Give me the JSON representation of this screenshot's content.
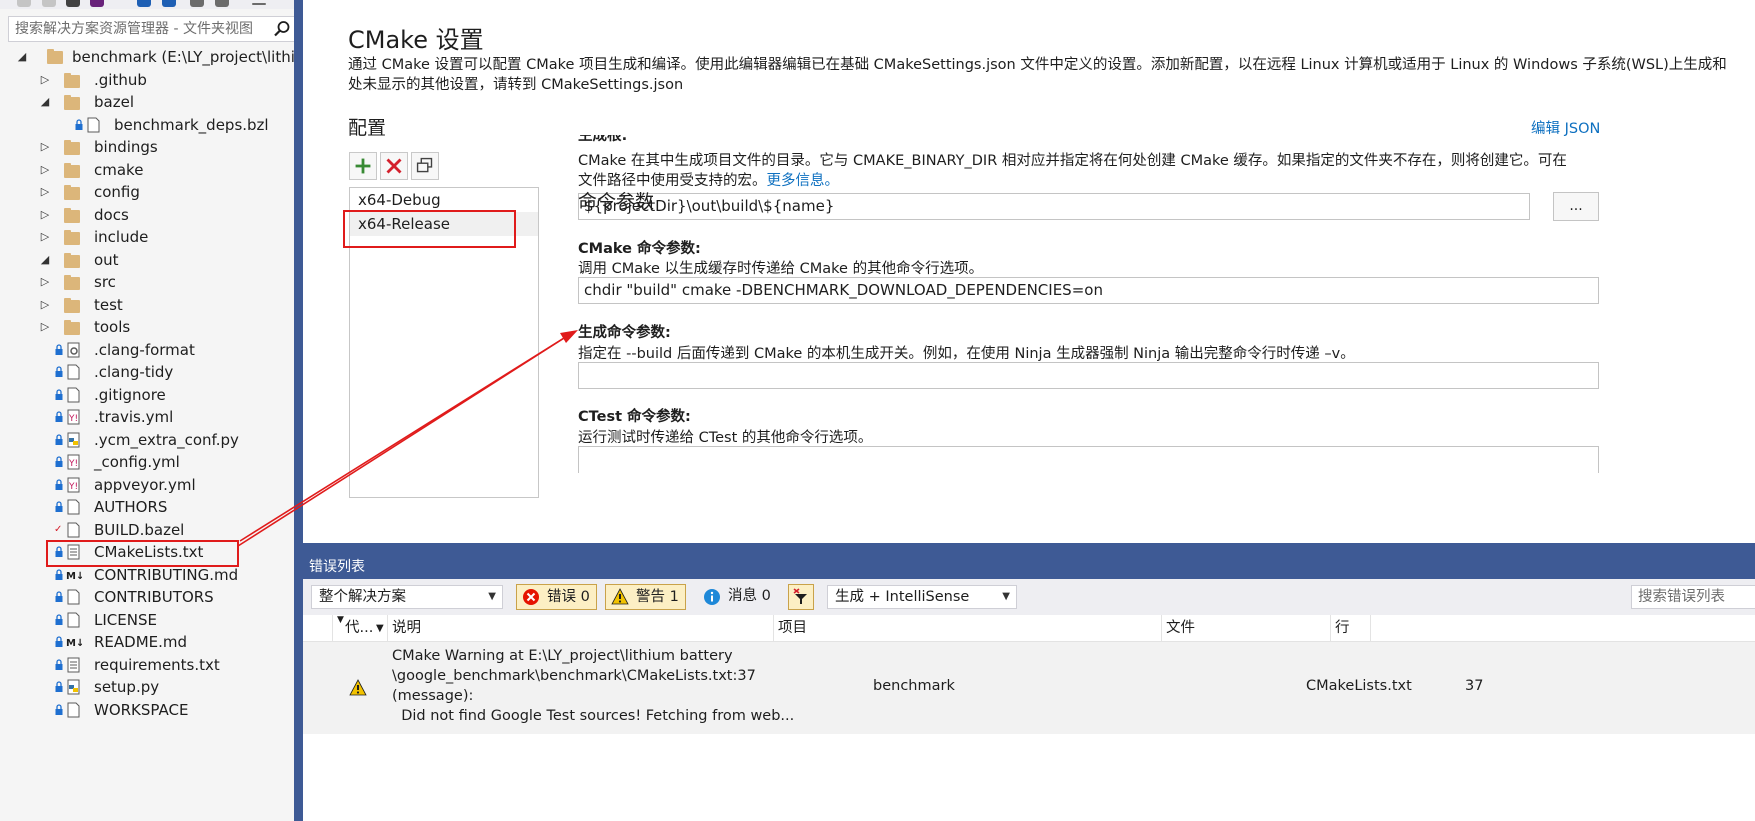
{
  "explorer": {
    "search_placeholder": "搜索解决方案资源管理器 - 文件夹视图",
    "root": {
      "label": "benchmark (E:\\LY_project\\lithium"
    },
    "items": [
      {
        "label": ".github",
        "kind": "folder",
        "expand": "collapsed"
      },
      {
        "label": "bazel",
        "kind": "folder-open",
        "expand": "expanded"
      },
      {
        "label": "benchmark_deps.bzl",
        "kind": "file",
        "lock": true
      },
      {
        "label": "bindings",
        "kind": "folder",
        "expand": "collapsed"
      },
      {
        "label": "cmake",
        "kind": "folder",
        "expand": "collapsed"
      },
      {
        "label": "config",
        "kind": "folder",
        "expand": "collapsed"
      },
      {
        "label": "docs",
        "kind": "folder",
        "expand": "collapsed"
      },
      {
        "label": "include",
        "kind": "folder",
        "expand": "collapsed"
      },
      {
        "label": "out",
        "kind": "folder-open",
        "expand": "expanded"
      },
      {
        "label": "src",
        "kind": "folder",
        "expand": "collapsed"
      },
      {
        "label": "test",
        "kind": "folder",
        "expand": "collapsed"
      },
      {
        "label": "tools",
        "kind": "folder",
        "expand": "collapsed"
      },
      {
        "label": ".clang-format",
        "kind": "config-file",
        "lock": true
      },
      {
        "label": ".clang-tidy",
        "kind": "file",
        "lock": true
      },
      {
        "label": ".gitignore",
        "kind": "file",
        "lock": true
      },
      {
        "label": ".travis.yml",
        "kind": "yml-file",
        "lock": true
      },
      {
        "label": ".ycm_extra_conf.py",
        "kind": "py-file",
        "lock": true
      },
      {
        "label": "_config.yml",
        "kind": "yml-file",
        "lock": true
      },
      {
        "label": "appveyor.yml",
        "kind": "yml-file",
        "lock": true
      },
      {
        "label": "AUTHORS",
        "kind": "file",
        "lock": true
      },
      {
        "label": "BUILD.bazel",
        "kind": "file",
        "check": true
      },
      {
        "label": "CMakeLists.txt",
        "kind": "text-file",
        "lock": true,
        "highlight": true
      },
      {
        "label": "CONTRIBUTING.md",
        "kind": "md-file",
        "lock": true
      },
      {
        "label": "CONTRIBUTORS",
        "kind": "file",
        "lock": true
      },
      {
        "label": "LICENSE",
        "kind": "file",
        "lock": true
      },
      {
        "label": "README.md",
        "kind": "md-file",
        "lock": true
      },
      {
        "label": "requirements.txt",
        "kind": "text-file",
        "lock": true
      },
      {
        "label": "setup.py",
        "kind": "py-file",
        "lock": true
      },
      {
        "label": "WORKSPACE",
        "kind": "file",
        "lock": true
      }
    ]
  },
  "cmake": {
    "title": "CMake 设置",
    "description_line1": "通过 CMake 设置可以配置 CMake 项目生成和编译。使用此编辑器编辑已在基础 CMakeSettings.json 文件中定义的设置。添加新配置，以在远程 Linux 计算机或适用于 Linux 的 Windows 子系统(WSL)上生成和",
    "description_line2": "处未显示的其他设置，请转到 CMakeSettings.json",
    "config_title": "配置",
    "edit_json": "编辑 JSON",
    "configs": [
      "x64-Debug",
      "x64-Release"
    ],
    "build_root": {
      "title_partial": "生成根:",
      "desc_line1": "CMake 在其中生成项目文件的目录。它与 CMAKE_BINARY_DIR 相对应并指定将在何处创建 CMake 缓存。如果指定的文件夹不存在，则将创建它。可在",
      "desc_line2": "文件路径中使用受支持的宏。",
      "more_info": "更多信息。",
      "value": "${projectDir}\\out\\build\\${name}",
      "browse": "..."
    },
    "command_args": {
      "section_title": "命令参数",
      "cmake_title": "CMake 命令参数:",
      "cmake_desc": "调用 CMake 以生成缓存时传递给 CMake 的其他命令行选项。",
      "cmake_value": "chdir \"build\" cmake -DBENCHMARK_DOWNLOAD_DEPENDENCIES=on",
      "build_title": "生成命令参数:",
      "build_desc": "指定在 --build 后面传递到 CMake 的本机生成开关。例如，在使用 Ninja 生成器强制 Ninja 输出完整命令行时传递 –v。",
      "build_value": "",
      "ctest_title": "CTest 命令参数:",
      "ctest_desc": "运行测试时传递给 CTest 的其他命令行选项。"
    }
  },
  "error_list": {
    "title": "错误列表",
    "scope": "整个解决方案",
    "errors_label": "错误 0",
    "warnings_label": "警告 1",
    "messages_label": "消息 0",
    "build_filter": "生成 + IntelliSense",
    "search_placeholder": "搜索错误列表",
    "columns": {
      "code": "代...",
      "desc": "说明",
      "project": "项目",
      "file": "文件",
      "line": "行"
    },
    "rows": [
      {
        "desc_lines": [
          "CMake Warning at E:\\LY_project\\lithium battery",
          "\\google_benchmark\\benchmark\\CMakeLists.txt:37",
          "(message):",
          "  Did not find Google Test sources! Fetching from web..."
        ],
        "project": "benchmark",
        "file": "CMakeLists.txt",
        "line": "37"
      }
    ]
  },
  "colors": {
    "accent": "#3e5a95",
    "highlight_red": "#e01b1b",
    "link": "#0e70c0",
    "folder": "#dcb67a"
  }
}
